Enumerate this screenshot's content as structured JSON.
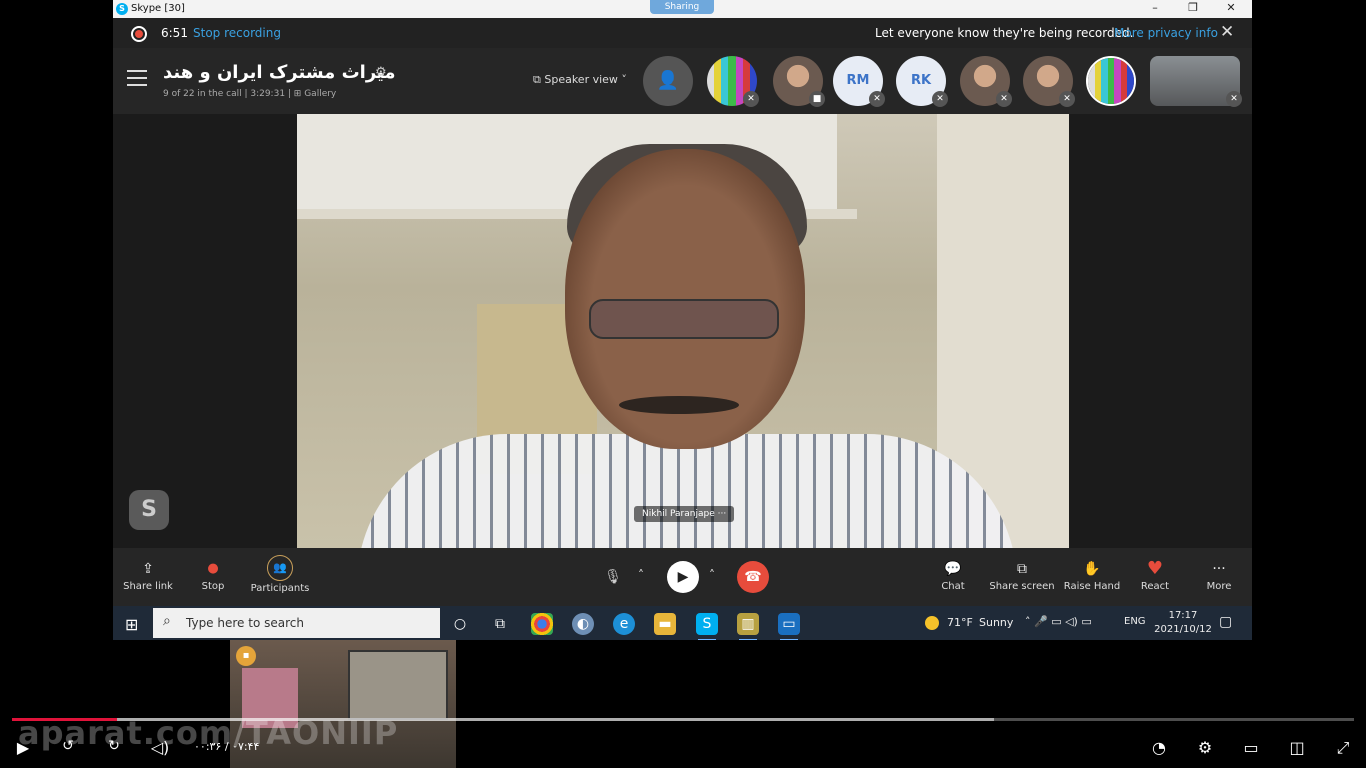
{
  "window": {
    "title": "Skype [30]",
    "sharing": "Sharing",
    "buttons": [
      "–",
      "❐",
      "✕"
    ]
  },
  "recording": {
    "time": "6:51",
    "stop_label": "Stop recording",
    "message": "Let everyone know they're being recorded.",
    "privacy_link": "More privacy info"
  },
  "call": {
    "title": "میراث مشترک ایران و هند",
    "subtitle": "9 of 22 in the call | 3:29:31 | ⊞ Gallery",
    "view_label": "Speaker view",
    "participants": [
      {
        "type": "bars"
      },
      {
        "type": "photo"
      },
      {
        "type": "initials",
        "initials": "RM"
      },
      {
        "type": "initials",
        "initials": "RK"
      },
      {
        "type": "photo"
      },
      {
        "type": "photo"
      },
      {
        "type": "bars"
      },
      {
        "type": "photo"
      }
    ],
    "speaker_name": "Nikhil Paranjape",
    "speaker_more": "···"
  },
  "controls": {
    "share_link": "Share link",
    "stop": "Stop",
    "participants": "Participants",
    "chat": "Chat",
    "share_screen": "Share screen",
    "raise_hand": "Raise Hand",
    "react": "React",
    "more": "More"
  },
  "taskbar": {
    "search_placeholder": "Type here to search",
    "temperature": "71°F",
    "condition": "Sunny",
    "language": "ENG",
    "time": "17:17",
    "date": "2021/10/12"
  },
  "player": {
    "watermark": "aparat.com/TAONIIP",
    "timecode": "۰۰:۳۶ / ۰۷:۴۴",
    "progress_played": 0.078,
    "progress_buffered": 0.732
  },
  "colors": {
    "accent_blue": "#3aa0e0",
    "record_red": "#e74c3c",
    "progress_red": "#e0133a",
    "taskbar": "#1f2a38"
  }
}
